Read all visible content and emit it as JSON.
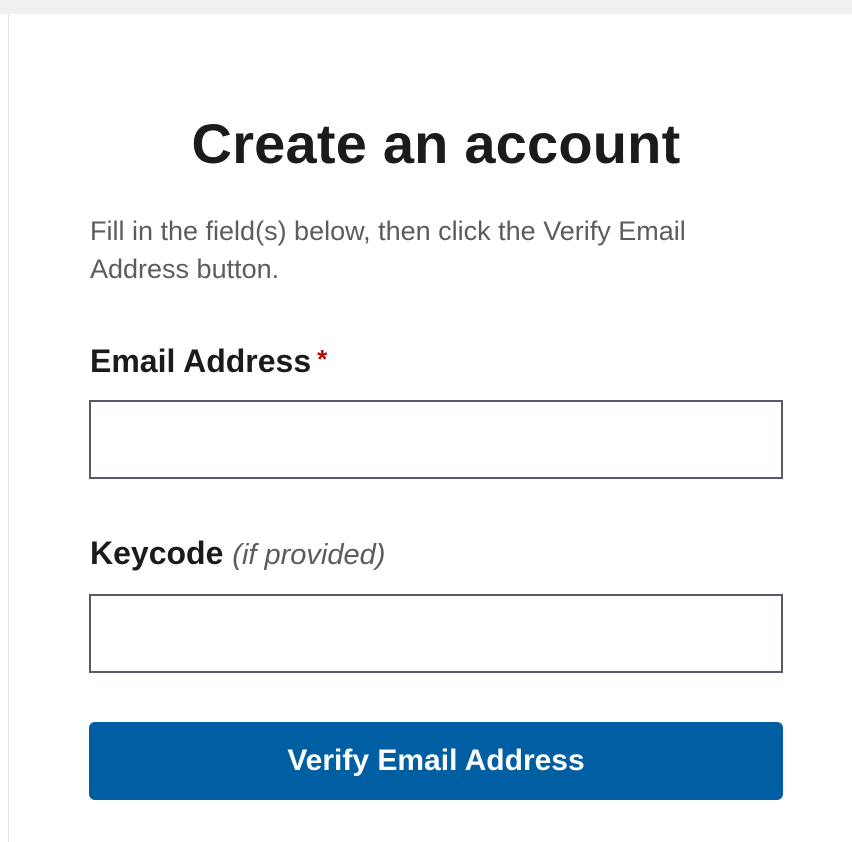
{
  "form": {
    "title": "Create an account",
    "intro": "Fill in the field(s) below, then click the Verify Email Address button.",
    "email": {
      "label": "Email Address",
      "required_mark": "*",
      "value": "",
      "placeholder": ""
    },
    "keycode": {
      "label": "Keycode",
      "hint": "(if provided)",
      "value": "",
      "placeholder": ""
    },
    "submit_label": "Verify Email Address"
  },
  "colors": {
    "primary_button": "#005ea2",
    "required": "#b50909",
    "heading_text": "#1b1b1b",
    "muted_text": "#5c5c5c",
    "input_border": "#565c65"
  }
}
